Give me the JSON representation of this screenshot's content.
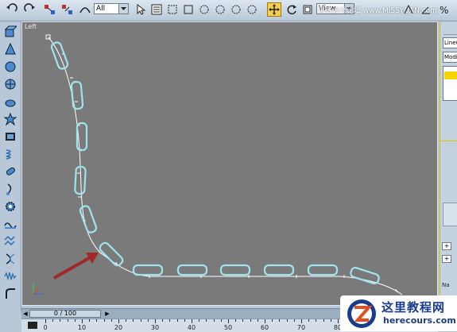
{
  "toolbar": {
    "selection_filter": "All",
    "reference_coord": "View",
    "watermark": "思缘设计论坛 www.MISSYUAN.com"
  },
  "viewport": {
    "label": "Left"
  },
  "command_panel": {
    "object_name": "LineC",
    "modifier_list": "Modi",
    "name_label": "Na"
  },
  "timeline": {
    "frame": "0 / 100"
  },
  "ruler": {
    "labels": [
      "0",
      "10",
      "20",
      "30",
      "40",
      "50",
      "60",
      "70",
      "80"
    ]
  },
  "logo": {
    "title": "这里教程网",
    "url": "herecours.com"
  },
  "colors": {
    "viewport_bg": "#7a7a7a",
    "link_shapes": "#9ee4f0",
    "spline": "#ffffff",
    "arrow": "#a02828",
    "active_tool": "#f6cf4a"
  }
}
